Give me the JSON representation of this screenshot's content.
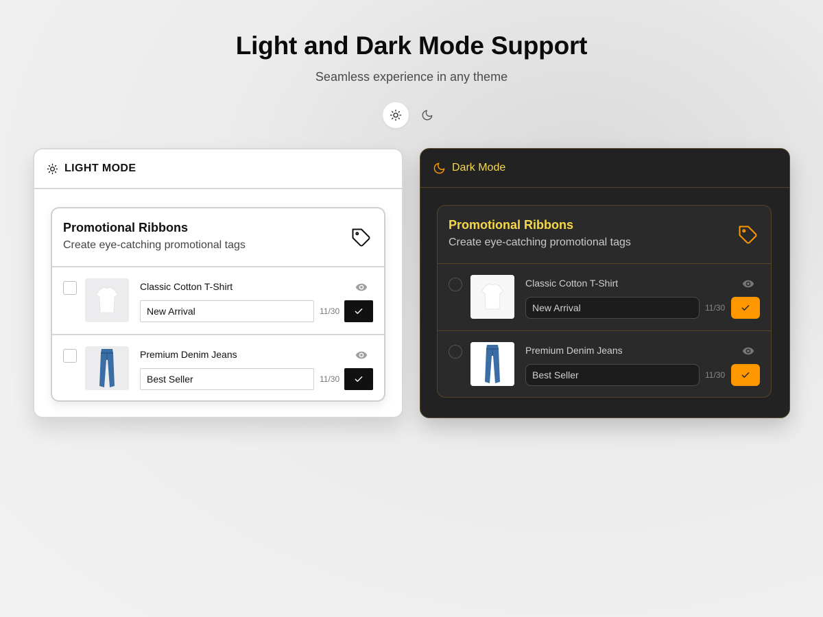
{
  "header": {
    "title": "Light and Dark Mode Support",
    "subtitle": "Seamless experience in any theme"
  },
  "theme_toggle": {
    "options": [
      {
        "icon": "sun-icon",
        "selected": true
      },
      {
        "icon": "moon-icon",
        "selected": false
      }
    ]
  },
  "light_panel": {
    "label": "LIGHT MODE",
    "icon": "sun-icon",
    "card": {
      "title": "Promotional Ribbons",
      "description": "Create eye-catching promotional tags",
      "icon": "tag-icon",
      "products": [
        {
          "name": "Classic Cotton T-Shirt",
          "ribbon": "New Arrival",
          "counter": "11/30",
          "thumbnail": "t-shirt"
        },
        {
          "name": "Premium Denim Jeans",
          "ribbon": "Best Seller",
          "counter": "11/30",
          "thumbnail": "jeans"
        }
      ]
    }
  },
  "dark_panel": {
    "label": "Dark Mode",
    "icon": "moon-icon",
    "card": {
      "title": "Promotional Ribbons",
      "description": "Create eye-catching promotional tags",
      "icon": "tag-icon",
      "products": [
        {
          "name": "Classic Cotton T-Shirt",
          "ribbon": "New Arrival",
          "counter": "11/30",
          "thumbnail": "t-shirt"
        },
        {
          "name": "Premium Denim Jeans",
          "ribbon": "Best Seller",
          "counter": "11/30",
          "thumbnail": "jeans"
        }
      ]
    }
  },
  "colors": {
    "dark_accent": "#ff9800",
    "dark_title": "#f5d84a",
    "light_button": "#111111"
  }
}
